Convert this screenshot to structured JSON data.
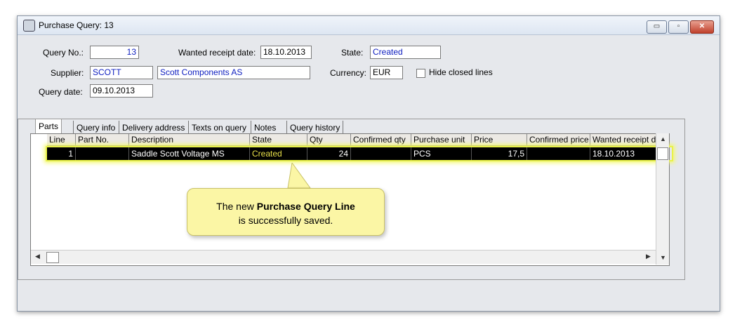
{
  "window": {
    "title": "Purchase Query: 13",
    "controls": {
      "minimize": "▭",
      "maximize": "▫",
      "close": "✕"
    }
  },
  "header": {
    "query_no_label": "Query No.:",
    "query_no_value": "13",
    "wanted_receipt_date_label": "Wanted receipt date:",
    "wanted_receipt_date_value": "18.10.2013",
    "state_label": "State:",
    "state_value": "Created",
    "supplier_label": "Supplier:",
    "supplier_id": "SCOTT",
    "supplier_name": "Scott Components AS",
    "currency_label": "Currency:",
    "currency_value": "EUR",
    "hide_closed_lines_label": "Hide closed lines",
    "query_date_label": "Query date:",
    "query_date_value": "09.10.2013"
  },
  "tabs": [
    "Parts",
    "Query info",
    "Delivery address",
    "Texts on query",
    "Notes",
    "Query history"
  ],
  "grid": {
    "columns": [
      "Line",
      "Part No.",
      "Description",
      "State",
      "Qty",
      "Confirmed qty",
      "Purchase unit",
      "Price",
      "Confirmed price",
      "Wanted receipt date"
    ],
    "rows": [
      [
        "1",
        "",
        "Saddle Scott Voltage MS",
        "Created",
        "24",
        "",
        "PCS",
        "17,5",
        "",
        "18.10.2013"
      ]
    ]
  },
  "callout": {
    "line1_prefix": "The new ",
    "line1_bold": "Purchase Query Line",
    "line2": "is successfully saved."
  },
  "colors": {
    "highlight": "#e9f24a",
    "selected_row": "#000000",
    "callout_bg": "#fbf6a5",
    "state_text": "#e8e04a",
    "link_blue": "#1020c0"
  }
}
